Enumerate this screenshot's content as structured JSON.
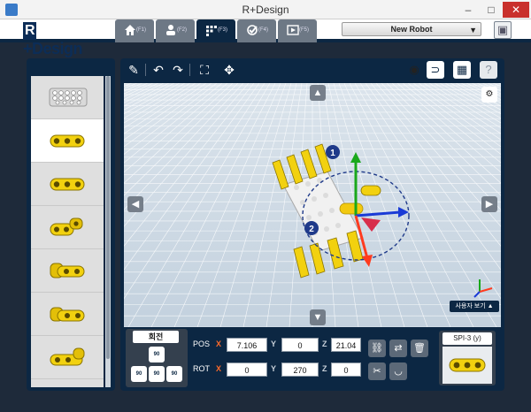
{
  "window": {
    "title": "R+Design",
    "min": "–",
    "max": "□",
    "close": "✕"
  },
  "logo": {
    "r": "R",
    "rest": "+Design"
  },
  "tabs": [
    {
      "key": "(F1)",
      "icon": "home-icon",
      "active": false
    },
    {
      "key": "(F2)",
      "icon": "person-icon",
      "active": false
    },
    {
      "key": "(F3)",
      "icon": "grid-icon",
      "active": true
    },
    {
      "key": "(F4)",
      "icon": "check-icon",
      "active": false
    },
    {
      "key": "(F5)",
      "icon": "play-icon",
      "active": false
    }
  ],
  "robot_select": {
    "value": "New Robot"
  },
  "viewport": {
    "user_view_label": "사용자 보기",
    "markers": [
      "1",
      "2"
    ]
  },
  "rotation": {
    "title": "회전",
    "deg": "90"
  },
  "position": {
    "label": "POS",
    "x": "7.106",
    "y": "0",
    "z": "21.04"
  },
  "rotate_vals": {
    "label": "ROT",
    "x": "0",
    "y": "270",
    "z": "0"
  },
  "axes": {
    "x": "X",
    "y": "Y",
    "z": "Z"
  },
  "selected_part": {
    "name": "SPI-3 (y)"
  },
  "colors": {
    "navy": "#0c2743",
    "part_yellow": "#f2d10f",
    "axis_x": "#ff3b1f",
    "axis_y": "#19a81b",
    "axis_z": "#1a3bd6"
  }
}
